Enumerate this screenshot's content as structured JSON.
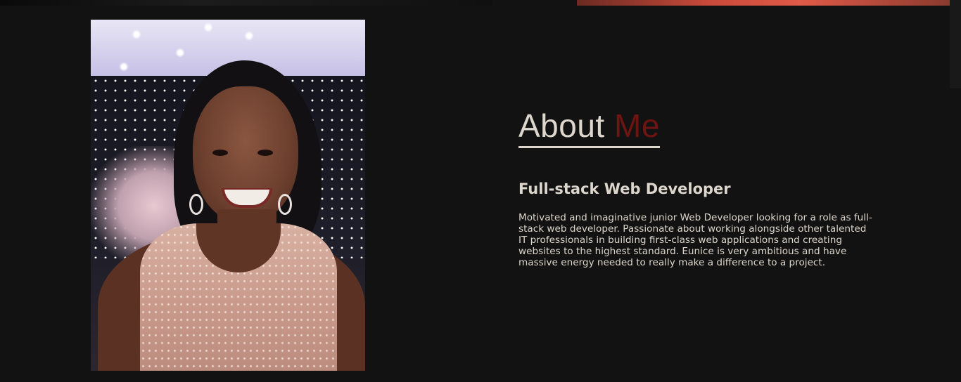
{
  "about": {
    "title_main": "About ",
    "title_accent": "Me",
    "role": "Full-stack Web Developer",
    "bio": "Motivated and imaginative junior Web Developer looking for a role as full-stack web developer. Passionate about working alongside other talented IT professionals in building first-class web applications and creating websites to the highest standard. Eunice is very ambitious and have massive energy needed to really make a difference to a project."
  },
  "colors": {
    "background": "#121212",
    "text": "#ddd6cc",
    "accent": "#6e1411"
  }
}
